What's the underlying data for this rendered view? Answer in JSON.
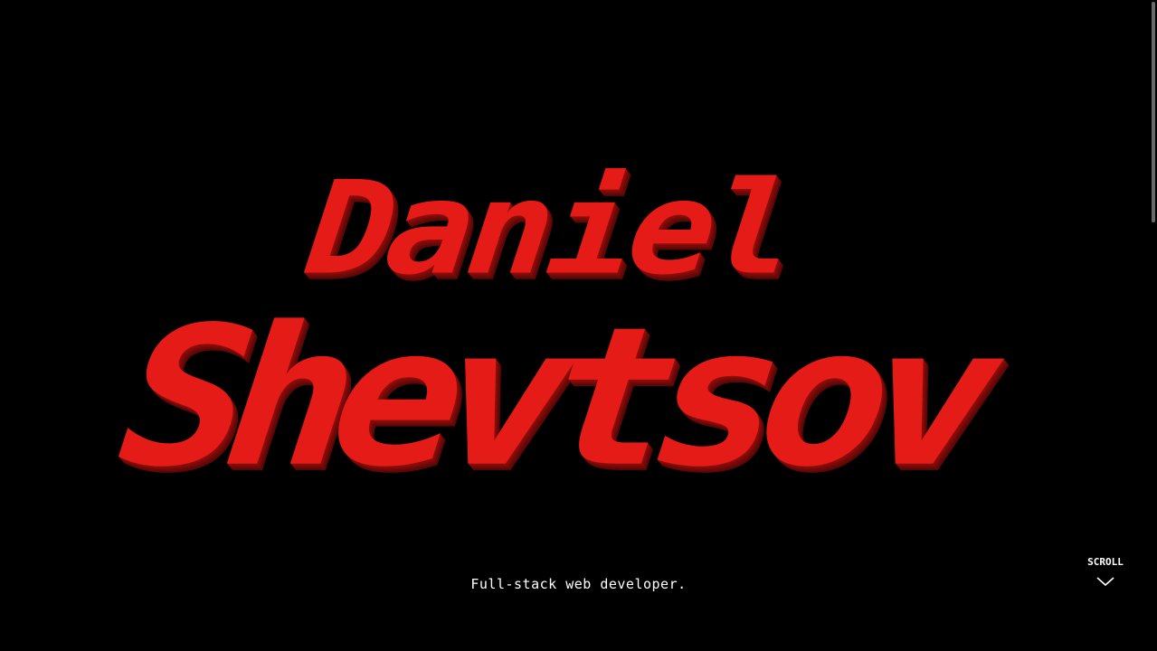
{
  "hero": {
    "name_line_1": "Daniel",
    "name_line_2": "Shevtsov",
    "tagline": "Full-stack web developer."
  },
  "scroll_indicator": {
    "label": "SCROLL",
    "icon": "chevron-down-icon"
  },
  "colors": {
    "background": "#000000",
    "name_face": "#e41b17",
    "name_shadow": "#7a0b09",
    "text": "#ffffff",
    "scrollbar_thumb": "#6a6a6a"
  }
}
